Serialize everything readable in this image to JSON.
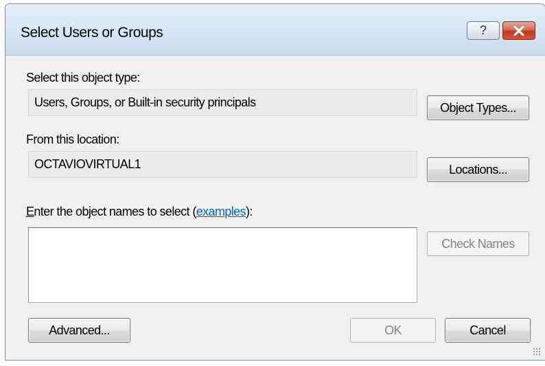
{
  "window": {
    "title": "Select Users or Groups",
    "help_glyph": "?",
    "close_icon": "close-x-icon",
    "colors": {
      "close_button": "#c2391d",
      "link": "#0066cc"
    }
  },
  "object_type": {
    "label": "Select this object type:",
    "value": "Users, Groups, or Built-in security principals",
    "button": "Object Types..."
  },
  "location": {
    "label": "From this location:",
    "value": "OCTAVIOVIRTUAL1",
    "button": "Locations..."
  },
  "names": {
    "label_mnemonic": "E",
    "label_rest": "nter the object names to select (",
    "link": "examples",
    "label_end": "):",
    "value": "",
    "check_button": "Check Names"
  },
  "footer": {
    "advanced_button": "Advanced...",
    "ok_button": "OK",
    "cancel_button": "Cancel"
  }
}
